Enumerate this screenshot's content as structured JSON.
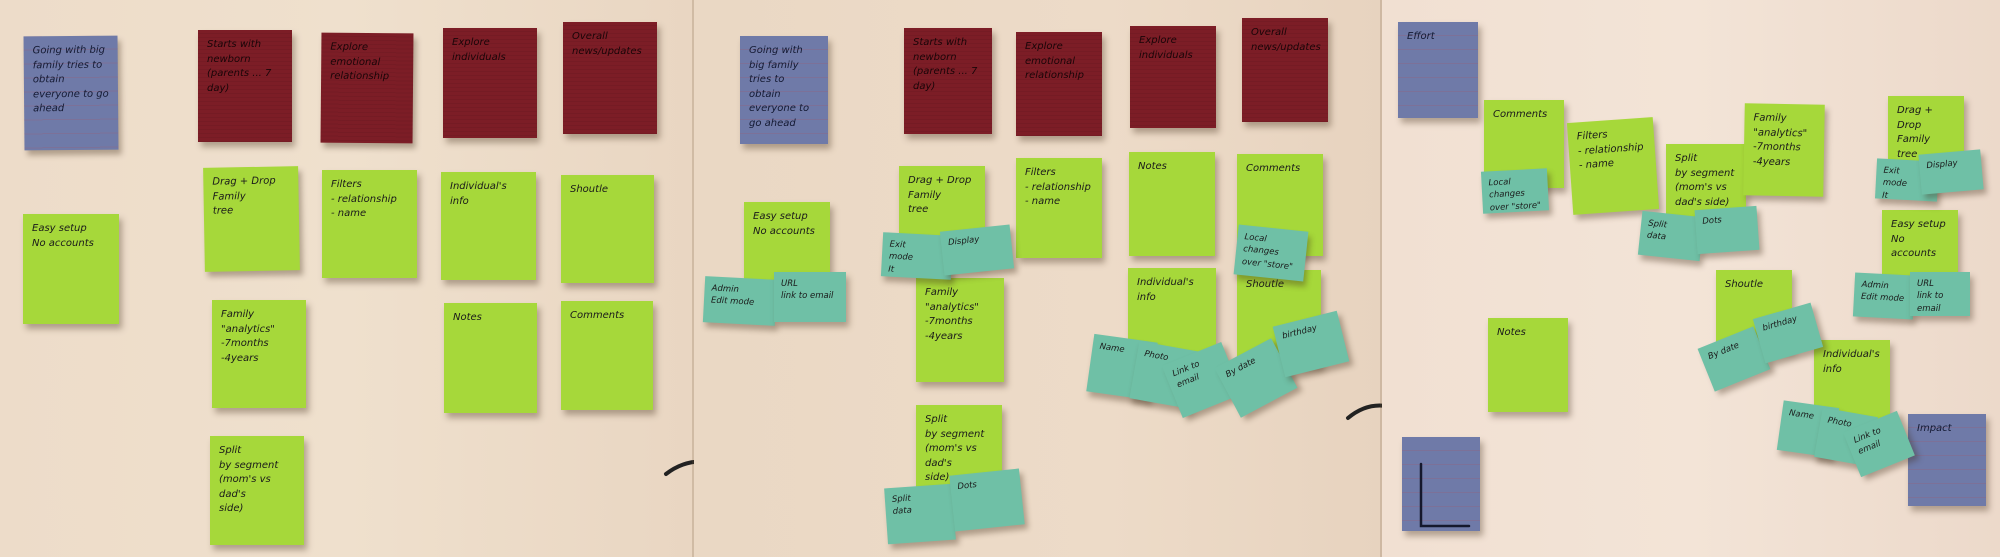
{
  "panel1": {
    "blue": "Going with big family tries to obtain everyone to go ahead",
    "red": [
      "Starts with newborn (parents ... 7 day)",
      "Explore emotional relationship",
      "Explore individuals",
      "Overall news/updates"
    ],
    "green": {
      "easy_setup": "Easy setup\nNo accounts",
      "drag_drop": "Drag + Drop\nFamily\ntree",
      "filters": "Filters\n- relationship\n- name",
      "individuals_info": "Individual's\ninfo",
      "shoutle": "Shoutle",
      "family_analytics": "Family\n\"analytics\"\n-7months\n-4years",
      "notes": "Notes",
      "comments": "Comments",
      "split": "Split\nby segment\n(mom's vs dad's\nside)"
    }
  },
  "panel2": {
    "blue": "Going with big family tries to obtain everyone to go ahead",
    "red": [
      "Starts with newborn (parents ... 7 day)",
      "Explore emotional relationship",
      "Explore individuals",
      "Overall news/updates"
    ],
    "green": {
      "easy_setup": "Easy setup\nNo accounts",
      "drag_drop": "Drag + Drop\nFamily\ntree",
      "filters": "Filters\n- relationship\n- name",
      "notes": "Notes",
      "comments": "Comments",
      "individuals_info": "Individual's\ninfo",
      "shoutle": "Shoutle",
      "family_analytics": "Family\n\"analytics\"\n-7months\n-4years",
      "split": "Split\nby segment\n(mom's vs dad's\nside)"
    },
    "teal": {
      "admin": "Admin\nEdit mode",
      "url": "URL\nlink to email",
      "exit": "Exit\nmode\nIt",
      "display": "Display",
      "local_changes": "Local changes\nover \"store\"",
      "name": "Name",
      "photo": "Photo",
      "link": "Link to\nemail",
      "by_date": "By date",
      "birthday": "birthday",
      "split_data": "Split\ndata",
      "dots": "Dots"
    }
  },
  "panel3": {
    "effort": "Effort",
    "impact": "Impact",
    "green": {
      "comments": "Comments",
      "filters": "Filters\n- relationship\n- name",
      "split": "Split\nby segment\n(mom's vs\ndad's side)",
      "family_analytics": "Family\n\"analytics\"\n-7months\n-4years",
      "drag_drop": "Drag + Drop\nFamily\ntree",
      "easy_setup": "Easy setup\nNo accounts",
      "notes": "Notes",
      "shoutle": "Shoutle",
      "individuals_info": "Individual's\ninfo"
    },
    "teal": {
      "local_changes": "Local changes\nover \"store\"",
      "split_data": "Split\ndata",
      "dots": "Dots",
      "exit": "Exit\nmode\nIt",
      "display": "Display",
      "admin": "Admin\nEdit mode",
      "url": "URL\nlink to email",
      "by_date": "By date",
      "birthday": "birthday",
      "name": "Name",
      "photo": "Photo",
      "link": "Link to\nemail"
    }
  },
  "colors": {
    "blue_note": "#6f7aa8",
    "red_note": "#7c1d26",
    "green_note": "#a6d83a",
    "teal_note": "#6fc0a6",
    "wall": "#ecdac7",
    "marker": "#1a1a1a"
  }
}
